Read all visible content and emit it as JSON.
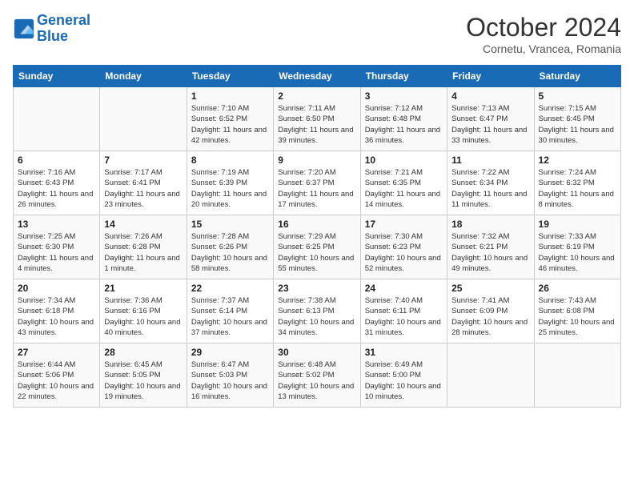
{
  "header": {
    "logo_line1": "General",
    "logo_line2": "Blue",
    "month_title": "October 2024",
    "location": "Cornetu, Vrancea, Romania"
  },
  "days_of_week": [
    "Sunday",
    "Monday",
    "Tuesday",
    "Wednesday",
    "Thursday",
    "Friday",
    "Saturday"
  ],
  "weeks": [
    [
      {
        "day": "",
        "info": ""
      },
      {
        "day": "",
        "info": ""
      },
      {
        "day": "1",
        "info": "Sunrise: 7:10 AM\nSunset: 6:52 PM\nDaylight: 11 hours and 42 minutes."
      },
      {
        "day": "2",
        "info": "Sunrise: 7:11 AM\nSunset: 6:50 PM\nDaylight: 11 hours and 39 minutes."
      },
      {
        "day": "3",
        "info": "Sunrise: 7:12 AM\nSunset: 6:48 PM\nDaylight: 11 hours and 36 minutes."
      },
      {
        "day": "4",
        "info": "Sunrise: 7:13 AM\nSunset: 6:47 PM\nDaylight: 11 hours and 33 minutes."
      },
      {
        "day": "5",
        "info": "Sunrise: 7:15 AM\nSunset: 6:45 PM\nDaylight: 11 hours and 30 minutes."
      }
    ],
    [
      {
        "day": "6",
        "info": "Sunrise: 7:16 AM\nSunset: 6:43 PM\nDaylight: 11 hours and 26 minutes."
      },
      {
        "day": "7",
        "info": "Sunrise: 7:17 AM\nSunset: 6:41 PM\nDaylight: 11 hours and 23 minutes."
      },
      {
        "day": "8",
        "info": "Sunrise: 7:19 AM\nSunset: 6:39 PM\nDaylight: 11 hours and 20 minutes."
      },
      {
        "day": "9",
        "info": "Sunrise: 7:20 AM\nSunset: 6:37 PM\nDaylight: 11 hours and 17 minutes."
      },
      {
        "day": "10",
        "info": "Sunrise: 7:21 AM\nSunset: 6:35 PM\nDaylight: 11 hours and 14 minutes."
      },
      {
        "day": "11",
        "info": "Sunrise: 7:22 AM\nSunset: 6:34 PM\nDaylight: 11 hours and 11 minutes."
      },
      {
        "day": "12",
        "info": "Sunrise: 7:24 AM\nSunset: 6:32 PM\nDaylight: 11 hours and 8 minutes."
      }
    ],
    [
      {
        "day": "13",
        "info": "Sunrise: 7:25 AM\nSunset: 6:30 PM\nDaylight: 11 hours and 4 minutes."
      },
      {
        "day": "14",
        "info": "Sunrise: 7:26 AM\nSunset: 6:28 PM\nDaylight: 11 hours and 1 minute."
      },
      {
        "day": "15",
        "info": "Sunrise: 7:28 AM\nSunset: 6:26 PM\nDaylight: 10 hours and 58 minutes."
      },
      {
        "day": "16",
        "info": "Sunrise: 7:29 AM\nSunset: 6:25 PM\nDaylight: 10 hours and 55 minutes."
      },
      {
        "day": "17",
        "info": "Sunrise: 7:30 AM\nSunset: 6:23 PM\nDaylight: 10 hours and 52 minutes."
      },
      {
        "day": "18",
        "info": "Sunrise: 7:32 AM\nSunset: 6:21 PM\nDaylight: 10 hours and 49 minutes."
      },
      {
        "day": "19",
        "info": "Sunrise: 7:33 AM\nSunset: 6:19 PM\nDaylight: 10 hours and 46 minutes."
      }
    ],
    [
      {
        "day": "20",
        "info": "Sunrise: 7:34 AM\nSunset: 6:18 PM\nDaylight: 10 hours and 43 minutes."
      },
      {
        "day": "21",
        "info": "Sunrise: 7:36 AM\nSunset: 6:16 PM\nDaylight: 10 hours and 40 minutes."
      },
      {
        "day": "22",
        "info": "Sunrise: 7:37 AM\nSunset: 6:14 PM\nDaylight: 10 hours and 37 minutes."
      },
      {
        "day": "23",
        "info": "Sunrise: 7:38 AM\nSunset: 6:13 PM\nDaylight: 10 hours and 34 minutes."
      },
      {
        "day": "24",
        "info": "Sunrise: 7:40 AM\nSunset: 6:11 PM\nDaylight: 10 hours and 31 minutes."
      },
      {
        "day": "25",
        "info": "Sunrise: 7:41 AM\nSunset: 6:09 PM\nDaylight: 10 hours and 28 minutes."
      },
      {
        "day": "26",
        "info": "Sunrise: 7:43 AM\nSunset: 6:08 PM\nDaylight: 10 hours and 25 minutes."
      }
    ],
    [
      {
        "day": "27",
        "info": "Sunrise: 6:44 AM\nSunset: 5:06 PM\nDaylight: 10 hours and 22 minutes."
      },
      {
        "day": "28",
        "info": "Sunrise: 6:45 AM\nSunset: 5:05 PM\nDaylight: 10 hours and 19 minutes."
      },
      {
        "day": "29",
        "info": "Sunrise: 6:47 AM\nSunset: 5:03 PM\nDaylight: 10 hours and 16 minutes."
      },
      {
        "day": "30",
        "info": "Sunrise: 6:48 AM\nSunset: 5:02 PM\nDaylight: 10 hours and 13 minutes."
      },
      {
        "day": "31",
        "info": "Sunrise: 6:49 AM\nSunset: 5:00 PM\nDaylight: 10 hours and 10 minutes."
      },
      {
        "day": "",
        "info": ""
      },
      {
        "day": "",
        "info": ""
      }
    ]
  ]
}
